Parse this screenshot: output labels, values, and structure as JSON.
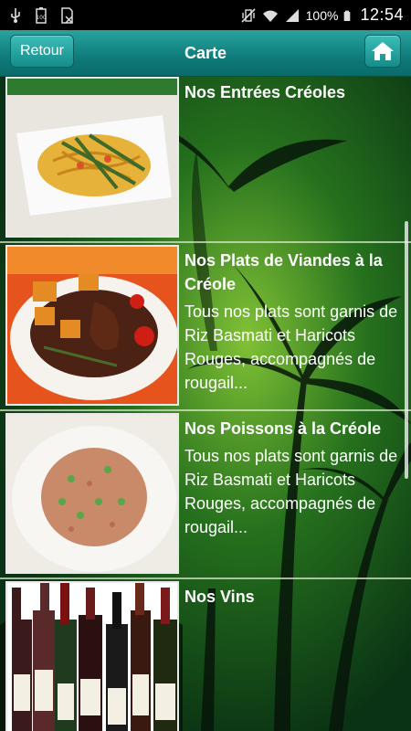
{
  "status_bar": {
    "battery_percent": "100%",
    "time": "12:54",
    "icons": [
      "usb-icon",
      "battery-saver-icon",
      "sd-card-off-icon",
      "vibrate-icon",
      "wifi-icon",
      "signal-icon",
      "battery-icon"
    ]
  },
  "action_bar": {
    "back_label": "Retour",
    "title": "Carte",
    "home_icon": "home-icon"
  },
  "menu": {
    "items": [
      {
        "title": "Nos Entrées Créoles",
        "description": "",
        "image": "shrimp-noodle-salad"
      },
      {
        "title": "Nos Plats de Viandes à la Créole",
        "description": "Tous nos plats sont garnis de Riz Basmati et Haricots Rouges, accompagnés de rougail...",
        "image": "creole-meat-stew"
      },
      {
        "title": "Nos Poissons à la Créole",
        "description": "Tous nos plats sont garnis de Riz Basmati et Haricots Rouges, accompagnés de rougail...",
        "image": "creole-fish-rice"
      },
      {
        "title": "Nos Vins",
        "description": "",
        "image": "wine-bottles"
      }
    ]
  },
  "colors": {
    "action_bar": "#0e7b7a",
    "button": "#168c89",
    "text": "#ffffff"
  }
}
